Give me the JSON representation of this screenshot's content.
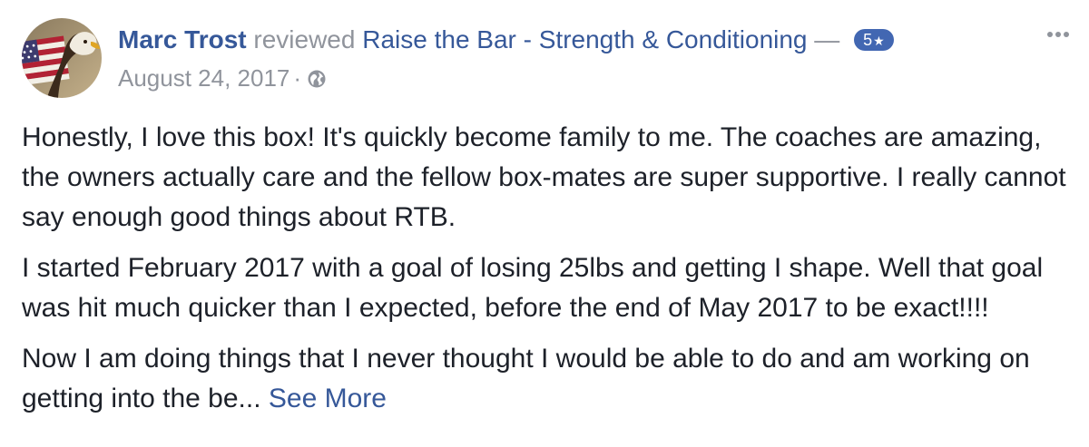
{
  "review": {
    "author": "Marc Trost",
    "verb": "reviewed",
    "page": "Raise the Bar - Strength & Conditioning",
    "dash": "—",
    "rating": "5",
    "date": "August 24, 2017",
    "separator": "·",
    "paragraphs": [
      "Honestly, I love this box! It's quickly become family to me. The coaches are amazing, the owners actually care and the fellow box-mates are super supportive. I really cannot say enough good things about RTB.",
      "I started February 2017 with a goal of losing 25lbs and getting I shape. Well that goal was hit much quicker than I expected, before the end of May 2017 to be exact!!!!",
      "Now I am doing things that I never thought I would be able to do and am working on getting into the be..."
    ],
    "see_more": "See More"
  },
  "icons": {
    "avatar": "avatar-eagle-flag",
    "privacy": "globe-icon",
    "menu": "more-options-icon",
    "rating_star": "star-icon"
  },
  "colors": {
    "link": "#365899",
    "muted": "#90949c",
    "text": "#1d2129",
    "badge": "#4267b2"
  }
}
